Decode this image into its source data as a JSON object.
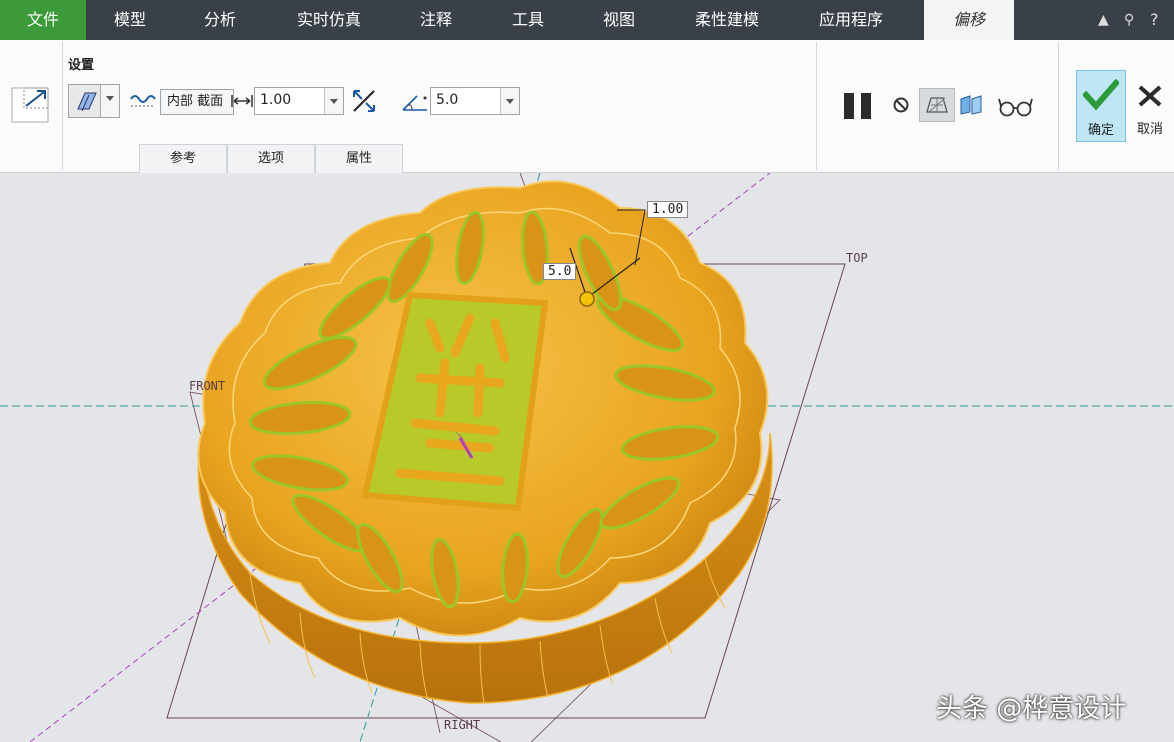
{
  "tabs": {
    "file": "文件",
    "model": "模型",
    "analysis": "分析",
    "simulation": "实时仿真",
    "annotate": "注释",
    "tools": "工具",
    "view": "视图",
    "flexible": "柔性建模",
    "apps": "应用程序",
    "offset": "偏移"
  },
  "ribbon": {
    "settings_title": "设置",
    "offset_type": "内部 截面",
    "distance_value": "1.00",
    "angle_value": "5.0",
    "subtabs": [
      "参考",
      "选项",
      "属性"
    ],
    "ok_label": "确定",
    "cancel_label": "取消"
  },
  "viewport": {
    "plane_top": "TOP",
    "plane_front": "FRONT",
    "plane_right": "RIGHT",
    "dim_distance": "1.00",
    "dim_angle": "5.0"
  },
  "watermark": "头条 @桦意设计",
  "colors": {
    "file_tab": "#3c9a3a",
    "tabbar": "#3a4047",
    "model": "#e8a418",
    "highlight": "#9bc62a",
    "ok_bg": "#bfe6f5"
  }
}
